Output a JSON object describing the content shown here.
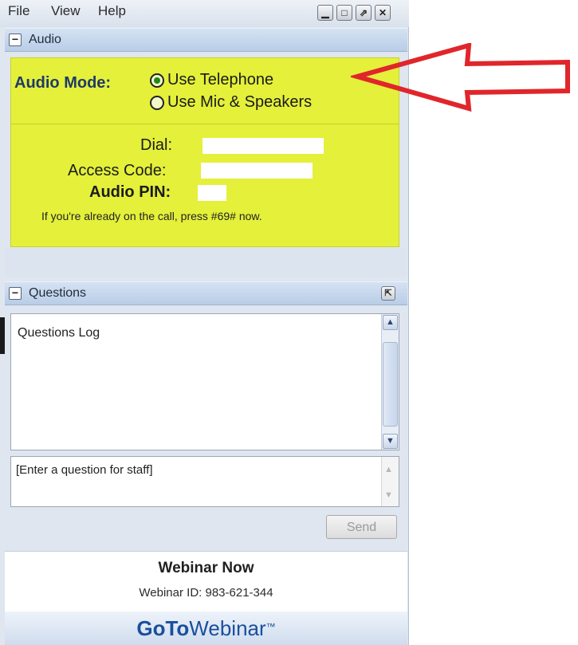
{
  "menu": {
    "file": "File",
    "view": "View",
    "help": "Help"
  },
  "window_controls": [
    "minimize-icon",
    "restore-icon",
    "popout-icon",
    "close-icon"
  ],
  "audio": {
    "header": "Audio",
    "mode_label": "Audio Mode:",
    "options": [
      "Use Telephone",
      "Use Mic & Speakers"
    ],
    "selected": "Use Telephone",
    "dial_label": "Dial:",
    "access_code_label": "Access Code:",
    "pin_label": "Audio PIN:",
    "note": "If you're already on the call, press #69# now."
  },
  "questions": {
    "header": "Questions",
    "log_title": "Questions Log",
    "input_placeholder": "[Enter a question for staff]",
    "send_label": "Send"
  },
  "webinar": {
    "name": "Webinar Now",
    "id_text": "Webinar ID: 983-621-344",
    "brand_bold": "GoTo",
    "brand_light": "Webinar",
    "brand_mark": "™"
  },
  "colors": {
    "audio_highlight": "#e4f03a",
    "annotation_arrow": "#e0262b",
    "brand_blue": "#1a4f9c"
  }
}
